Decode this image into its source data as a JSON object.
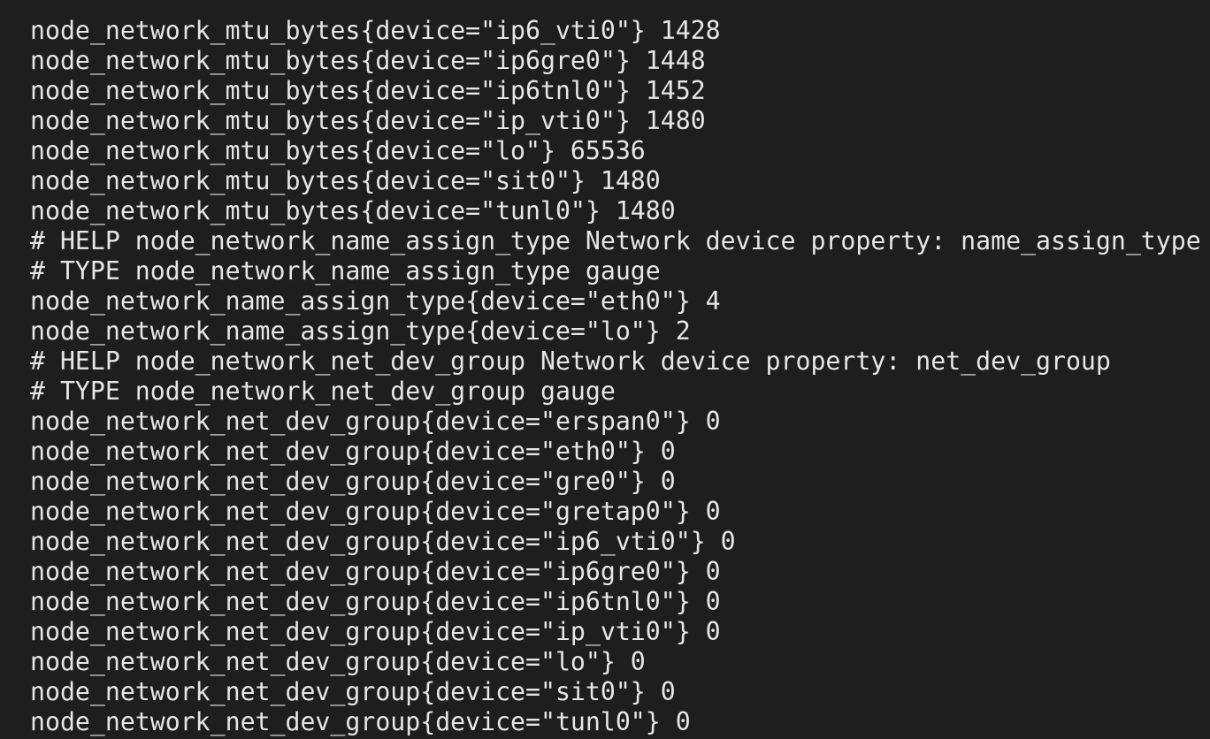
{
  "terminal": {
    "text_color": "#e6e6e6",
    "background_color": "#1e1e1e",
    "lines": [
      "node_network_mtu_bytes{device=\"ip6_vti0\"} 1428",
      "node_network_mtu_bytes{device=\"ip6gre0\"} 1448",
      "node_network_mtu_bytes{device=\"ip6tnl0\"} 1452",
      "node_network_mtu_bytes{device=\"ip_vti0\"} 1480",
      "node_network_mtu_bytes{device=\"lo\"} 65536",
      "node_network_mtu_bytes{device=\"sit0\"} 1480",
      "node_network_mtu_bytes{device=\"tunl0\"} 1480",
      "# HELP node_network_name_assign_type Network device property: name_assign_type",
      "# TYPE node_network_name_assign_type gauge",
      "node_network_name_assign_type{device=\"eth0\"} 4",
      "node_network_name_assign_type{device=\"lo\"} 2",
      "# HELP node_network_net_dev_group Network device property: net_dev_group",
      "# TYPE node_network_net_dev_group gauge",
      "node_network_net_dev_group{device=\"erspan0\"} 0",
      "node_network_net_dev_group{device=\"eth0\"} 0",
      "node_network_net_dev_group{device=\"gre0\"} 0",
      "node_network_net_dev_group{device=\"gretap0\"} 0",
      "node_network_net_dev_group{device=\"ip6_vti0\"} 0",
      "node_network_net_dev_group{device=\"ip6gre0\"} 0",
      "node_network_net_dev_group{device=\"ip6tnl0\"} 0",
      "node_network_net_dev_group{device=\"ip_vti0\"} 0",
      "node_network_net_dev_group{device=\"lo\"} 0",
      "node_network_net_dev_group{device=\"sit0\"} 0",
      "node_network_net_dev_group{device=\"tunl0\"} 0"
    ]
  }
}
